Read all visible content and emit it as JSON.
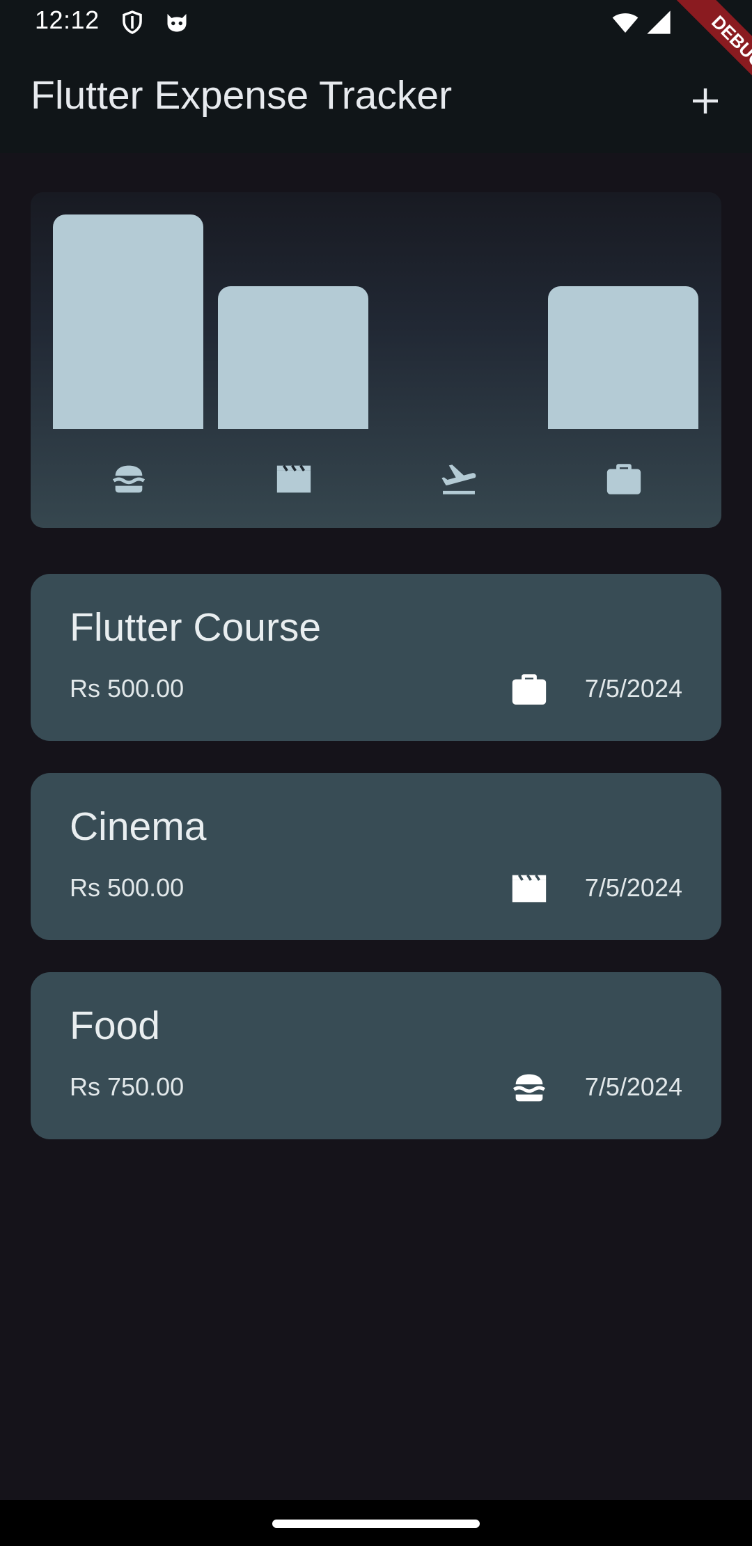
{
  "status_bar": {
    "time": "12:12"
  },
  "app_bar": {
    "title": "Flutter Expense Tracker",
    "add_icon": "plus-icon"
  },
  "debug_banner": {
    "label": "DEBUG"
  },
  "chart": {
    "categories": [
      "food",
      "leisure",
      "travel",
      "work"
    ],
    "icons": [
      "hamburger-icon",
      "movie-clapper-icon",
      "flight-takeoff-icon",
      "work-briefcase-icon"
    ],
    "values": [
      750,
      500,
      0,
      500
    ],
    "bar_color": "#b4cbd5"
  },
  "expenses": [
    {
      "title": "Flutter Course",
      "amount": "Rs 500.00",
      "date": "7/5/2024",
      "icon": "work-briefcase-icon"
    },
    {
      "title": "Cinema",
      "amount": "Rs 500.00",
      "date": "7/5/2024",
      "icon": "movie-clapper-icon"
    },
    {
      "title": "Food",
      "amount": "Rs 750.00",
      "date": "7/5/2024",
      "icon": "hamburger-icon"
    }
  ],
  "colors": {
    "background": "#15131a",
    "app_bar": "#101518",
    "card": "#384c55",
    "debug_ribbon": "#8a1b20"
  }
}
